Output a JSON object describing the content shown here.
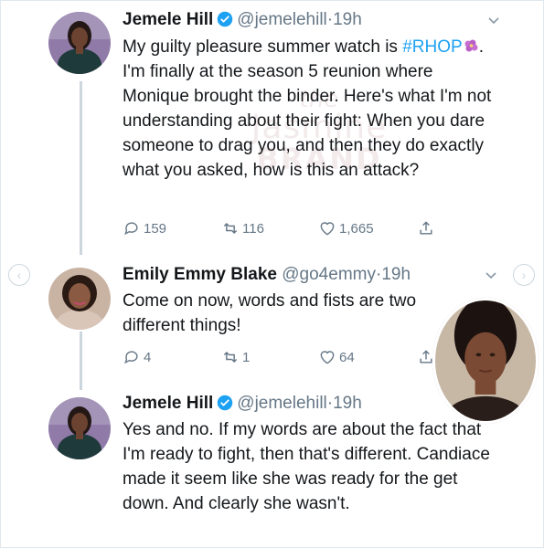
{
  "watermark": {
    "line1": "the",
    "line2": "Jasmine",
    "line3": "BRAND"
  },
  "tweets": [
    {
      "name": "Jemele Hill",
      "handle": "@jemelehill",
      "separator": "·",
      "time": "19h",
      "text_before": "My guilty pleasure summer watch is ",
      "hashtag": "#RHOP",
      "text_after": ". I'm finally at the season 5 reunion where Monique brought the binder. Here's what I'm not understanding about their fight: When you dare someone to drag you, and then they do exactly what you asked, how is this an attack?",
      "replies": "159",
      "retweets": "116",
      "likes": "1,665"
    },
    {
      "name": "Emily Emmy Blake",
      "handle": "@go4emmy",
      "separator": "·",
      "time": "19h",
      "text": "Come on now, words and fists are two different things!",
      "replies": "4",
      "retweets": "1",
      "likes": "64"
    },
    {
      "name": "Jemele Hill",
      "handle": "@jemelehill",
      "separator": "·",
      "time": "19h",
      "text": "Yes and no. If my words are about the fact that I'm ready to fight, then that's different. Candiace made it seem like she was ready for the get down. And clearly she wasn't."
    }
  ],
  "colors": {
    "link": "#1da1f2",
    "muted": "#657786",
    "thread_line": "#ccd6dd"
  }
}
